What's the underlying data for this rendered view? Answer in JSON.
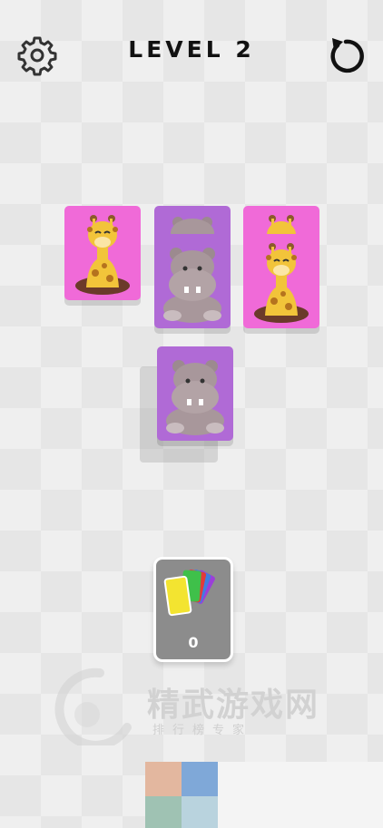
{
  "header": {
    "title": "LEVEL 2",
    "settings_icon": "gear-icon",
    "restart_icon": "restart-icon"
  },
  "tiles": [
    {
      "animal": "giraffe",
      "color": "#f06ad8"
    },
    {
      "animal": "hippo",
      "color": "#b06ad6"
    },
    {
      "animal": "giraffe",
      "color": "#f06ad8"
    },
    {
      "animal": "hippo",
      "color": "#b06ad6"
    },
    {
      "animal": "giraffe",
      "color": "#f06ad8"
    },
    {
      "animal": "hippo",
      "color": "#b06ad6"
    }
  ],
  "deck": {
    "count": "0",
    "icon": "card-fan-icon"
  },
  "watermark": {
    "main": "精武游戏网",
    "sub": "排行榜专家"
  },
  "slot_colors": [
    "#e3b79f",
    "#7fa8d8",
    "#9fc2b3",
    "#b9d3de"
  ]
}
